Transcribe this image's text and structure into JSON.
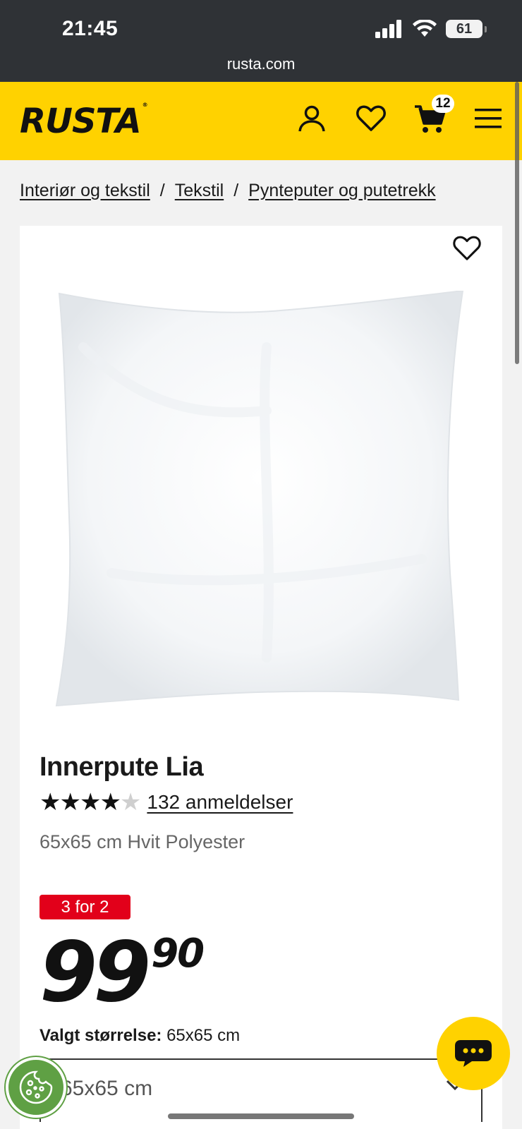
{
  "status_bar": {
    "time": "21:45",
    "battery": "61",
    "url": "rusta.com"
  },
  "header": {
    "logo": "RUSTA",
    "logo_mark": "®",
    "cart_count": "12"
  },
  "breadcrumb": [
    {
      "label": "Interiør og tekstil"
    },
    {
      "label": "Tekstil"
    },
    {
      "label": "Pynteputer og putetrekk"
    }
  ],
  "breadcrumb_separator": "/",
  "product": {
    "title": "Innerpute Lia",
    "rating": 4.5,
    "rating_stars": "★★★★",
    "rating_half_star": "★",
    "reviews": "132 anmeldelser",
    "subtitle": "65x65 cm Hvit Polyester",
    "promo_badge": "3 for 2",
    "price_main": "99",
    "price_decimals": "90",
    "size_label": "Valgt størrelse:",
    "size_value": "65x65 cm",
    "size_select_value": "65x65 cm"
  },
  "colors": {
    "brand_yellow": "#ffd200",
    "promo_red": "#e2001a",
    "cookie_green": "#5fa044",
    "status_bar": "#2f3236"
  },
  "icons": [
    "account-icon",
    "heart-icon",
    "cart-icon",
    "menu-icon",
    "wishlist-heart-icon",
    "chevron-down-icon",
    "chat-icon",
    "cookie-icon"
  ]
}
